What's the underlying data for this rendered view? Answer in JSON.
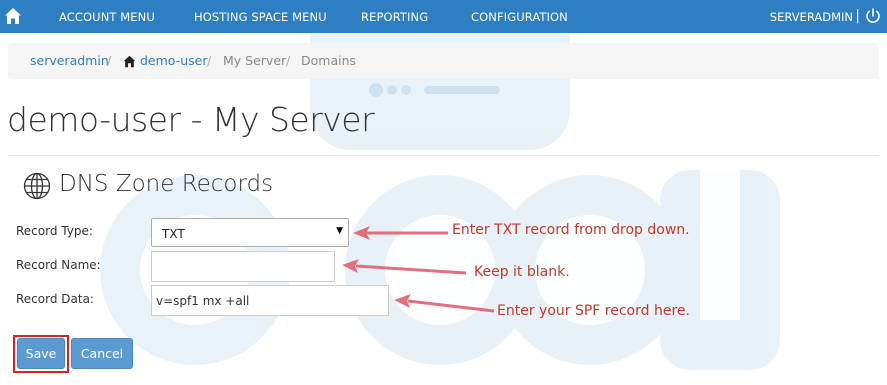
{
  "nav": {
    "items": [
      "ACCOUNT MENU",
      "HOSTING SPACE MENU",
      "REPORTING",
      "CONFIGURATION"
    ],
    "user": "SERVERADMIN",
    "separator": "|",
    "home_icon": "home-icon",
    "power_icon": "power-icon",
    "background": "#2d7fc1"
  },
  "breadcrumb": {
    "items": [
      "serveradmin",
      "demo-user",
      "My Server",
      "Domains"
    ],
    "separator": "/"
  },
  "page": {
    "title": "demo-user - My Server"
  },
  "section": {
    "title": "DNS Zone Records",
    "icon": "globe-icon"
  },
  "form": {
    "record_type_label": "Record Type:",
    "record_type_value": "TXT",
    "record_name_label": "Record Name:",
    "record_name_value": "",
    "record_data_label": "Record Data:",
    "record_data_value": "v=spf1 mx +all"
  },
  "buttons": {
    "save": "Save",
    "cancel": "Cancel"
  },
  "annotations": {
    "record_type": "Enter TXT record from drop down.",
    "record_name": "Keep it blank.",
    "record_data": "Enter your SPF record here.",
    "color": "#c0392b"
  }
}
